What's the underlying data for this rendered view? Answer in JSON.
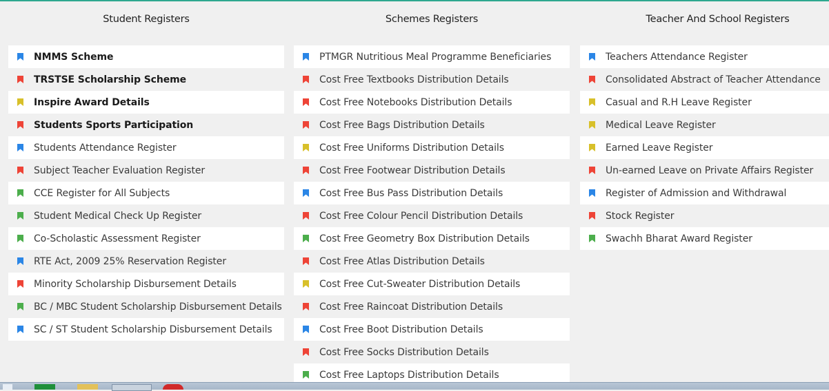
{
  "colors": {
    "blue": "#2b86e6",
    "red": "#ee4437",
    "yellow": "#d8c02a",
    "green": "#4cae4c",
    "accent_line": "#2ea88f"
  },
  "columns": [
    {
      "title": "Student Registers",
      "items": [
        {
          "label": "NMMS Scheme",
          "color": "blue",
          "bold": true
        },
        {
          "label": "TRSTSE Scholarship Scheme",
          "color": "red",
          "bold": true
        },
        {
          "label": "Inspire Award Details",
          "color": "yellow",
          "bold": true
        },
        {
          "label": "Students Sports Participation",
          "color": "red",
          "bold": true
        },
        {
          "label": "Students Attendance Register",
          "color": "blue",
          "bold": false
        },
        {
          "label": "Subject Teacher Evaluation Register",
          "color": "red",
          "bold": false
        },
        {
          "label": "CCE Register for All Subjects",
          "color": "green",
          "bold": false
        },
        {
          "label": "Student Medical Check Up Register",
          "color": "green",
          "bold": false
        },
        {
          "label": "Co-Scholastic Assessment Register",
          "color": "green",
          "bold": false
        },
        {
          "label": "RTE Act, 2009 25% Reservation Register",
          "color": "blue",
          "bold": false
        },
        {
          "label": "Minority Scholarship Disbursement Details",
          "color": "red",
          "bold": false
        },
        {
          "label": "BC / MBC Student Scholarship Disbursement Details",
          "color": "green",
          "bold": false
        },
        {
          "label": "SC / ST Student Scholarship Disbursement Details",
          "color": "blue",
          "bold": false
        }
      ]
    },
    {
      "title": "Schemes Registers",
      "items": [
        {
          "label": "PTMGR Nutritious Meal Programme Beneficiaries",
          "color": "blue",
          "bold": false
        },
        {
          "label": "Cost Free Textbooks Distribution Details",
          "color": "red",
          "bold": false
        },
        {
          "label": "Cost Free Notebooks Distribution Details",
          "color": "red",
          "bold": false
        },
        {
          "label": "Cost Free Bags Distribution Details",
          "color": "red",
          "bold": false
        },
        {
          "label": "Cost Free Uniforms Distribution Details",
          "color": "yellow",
          "bold": false
        },
        {
          "label": "Cost Free Footwear Distribution Details",
          "color": "red",
          "bold": false
        },
        {
          "label": "Cost Free Bus Pass Distribution Details",
          "color": "blue",
          "bold": false
        },
        {
          "label": "Cost Free Colour Pencil Distribution Details",
          "color": "red",
          "bold": false
        },
        {
          "label": "Cost Free Geometry Box Distribution Details",
          "color": "green",
          "bold": false
        },
        {
          "label": "Cost Free Atlas Distribution Details",
          "color": "red",
          "bold": false
        },
        {
          "label": "Cost Free Cut-Sweater Distribution Details",
          "color": "yellow",
          "bold": false
        },
        {
          "label": "Cost Free Raincoat Distribution Details",
          "color": "red",
          "bold": false
        },
        {
          "label": "Cost Free Boot Distribution Details",
          "color": "blue",
          "bold": false
        },
        {
          "label": "Cost Free Socks Distribution Details",
          "color": "red",
          "bold": false
        },
        {
          "label": "Cost Free Laptops Distribution Details",
          "color": "green",
          "bold": false
        }
      ]
    },
    {
      "title": "Teacher And School Registers",
      "items": [
        {
          "label": "Teachers Attendance Register",
          "color": "blue",
          "bold": false
        },
        {
          "label": "Consolidated Abstract of Teacher Attendance",
          "color": "red",
          "bold": false
        },
        {
          "label": "Casual and R.H Leave Register",
          "color": "yellow",
          "bold": false
        },
        {
          "label": "Medical Leave Register",
          "color": "yellow",
          "bold": false
        },
        {
          "label": "Earned Leave Register",
          "color": "yellow",
          "bold": false
        },
        {
          "label": "Un-earned Leave on Private Affairs Register",
          "color": "red",
          "bold": false
        },
        {
          "label": "Register of Admission and Withdrawal",
          "color": "blue",
          "bold": false
        },
        {
          "label": "Stock Register",
          "color": "red",
          "bold": false
        },
        {
          "label": "Swachh Bharat Award Register",
          "color": "green",
          "bold": false
        }
      ]
    }
  ]
}
